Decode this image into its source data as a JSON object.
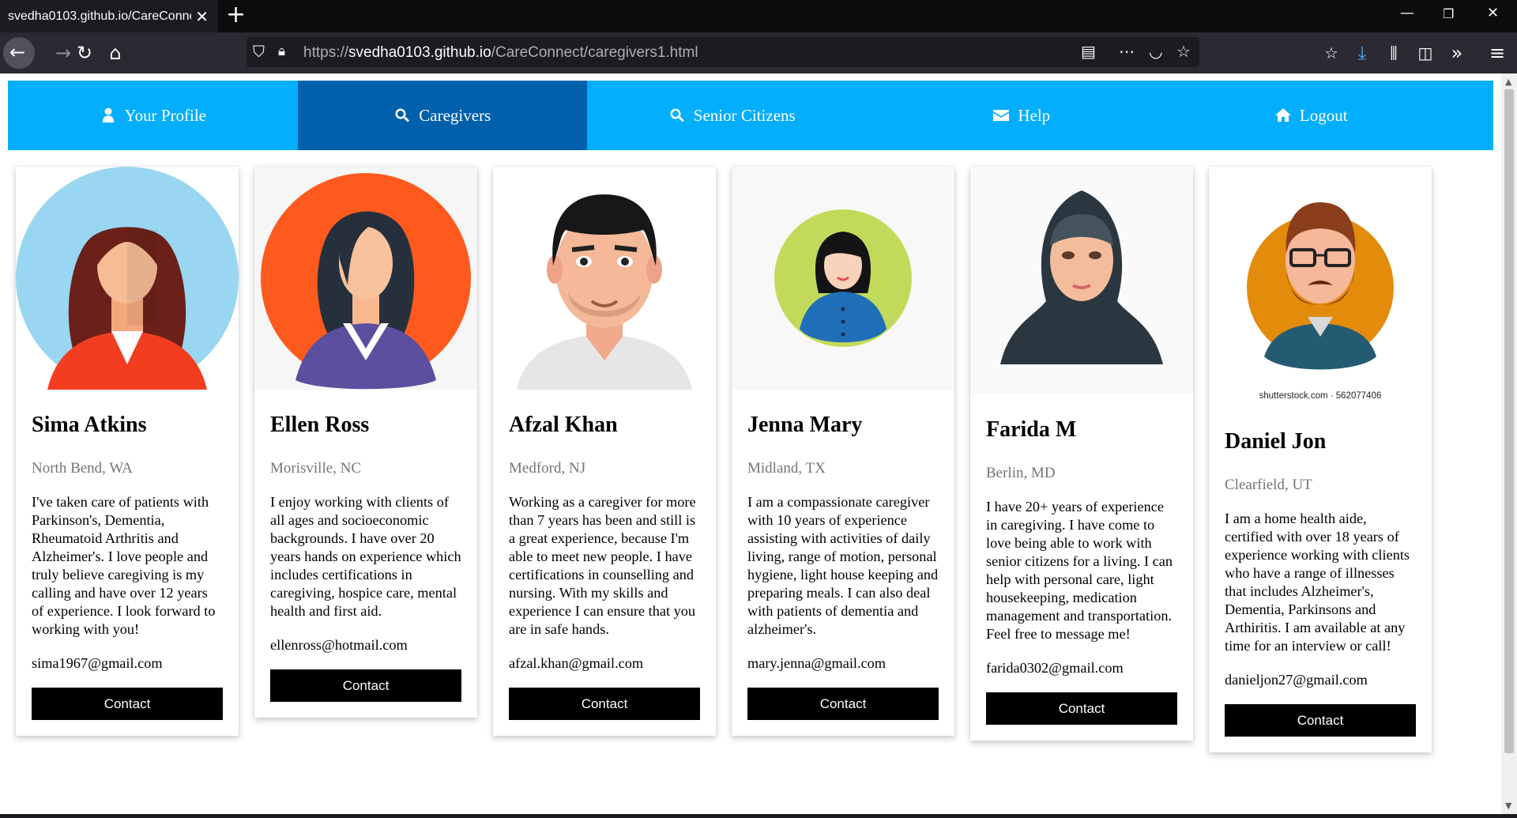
{
  "browser": {
    "tab_title": "svedha0103.github.io/CareConne",
    "url_prefix": "https://",
    "url_host": "svedha0103.github.io",
    "url_path": "/CareConnect/caregivers1.html"
  },
  "colors": {
    "nav_bg": "#03aefc",
    "nav_active": "#0060ac",
    "button_bg": "#000000"
  },
  "nav": {
    "items": [
      {
        "label": "Your Profile",
        "icon": "user-icon"
      },
      {
        "label": "Caregivers",
        "icon": "search-icon"
      },
      {
        "label": "Senior Citizens",
        "icon": "search-icon"
      },
      {
        "label": "Help",
        "icon": "envelope-icon"
      },
      {
        "label": "Logout",
        "icon": "home-icon"
      }
    ],
    "active_index": 1
  },
  "cards": [
    {
      "name": "Sima Atkins",
      "location": "North Bend, WA",
      "bio": "I've taken care of patients with Parkinson's, Dementia, Rheumatoid Arthritis and Alzheimer's. I love people and truly believe caregiving is my calling and have over 12 years of experience. I look forward to working with you!",
      "email": "sima1967@gmail.com",
      "button": "Contact",
      "avatar": "woman-avatar-icon"
    },
    {
      "name": "Ellen Ross",
      "location": "Morisville, NC",
      "bio": "I enjoy working with clients of all ages and socioeconomic backgrounds. I have over 20 years hands on experience which includes certifications in caregiving, hospice care, mental health and first aid.",
      "email": "ellenross@hotmail.com",
      "button": "Contact",
      "avatar": "woman-avatar-icon"
    },
    {
      "name": "Afzal Khan",
      "location": "Medford, NJ",
      "bio": "Working as a caregiver for more than 7 years has been and still is a great experience, because I'm able to meet new people. I have certifications in counselling and nursing. With my skills and experience I can ensure that you are in safe hands.",
      "email": "afzal.khan@gmail.com",
      "button": "Contact",
      "avatar": "man-avatar-icon"
    },
    {
      "name": "Jenna Mary",
      "location": "Midland, TX",
      "bio": "I am a compassionate caregiver with 10 years of experience assisting with activities of daily living, range of motion, personal hygiene, light house keeping and preparing meals. I can also deal with patients of dementia and alzheimer's.",
      "email": "mary.jenna@gmail.com",
      "button": "Contact",
      "avatar": "woman-avatar-icon"
    },
    {
      "name": "Farida M",
      "location": "Berlin, MD",
      "bio": "I have 20+ years of experience in caregiving. I have come to love being able to work with senior citizens for a living. I can help with personal care, light housekeeping, medication management and transportation. Feel free to message me!",
      "email": "farida0302@gmail.com",
      "button": "Contact",
      "avatar": "hijab-woman-avatar-icon"
    },
    {
      "name": "Daniel Jon",
      "location": "Clearfield, UT",
      "bio": "I am a home health aide, certified with over 18 years of experience working with clients who have a range of illnesses that includes Alzheimer's, Dementia, Parkinsons and Arthiritis. I am available at any time for an interview or call!",
      "email": "danieljon27@gmail.com",
      "button": "Contact",
      "avatar": "bearded-man-avatar-icon",
      "image_caption": "shutterstock.com · 562077406"
    }
  ]
}
